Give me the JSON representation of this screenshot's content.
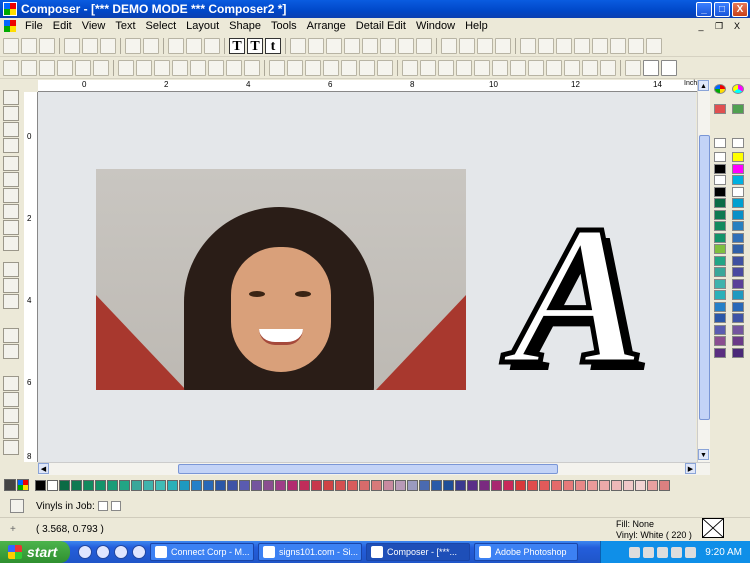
{
  "window": {
    "title": "Composer - [*** DEMO MODE *** Composer2 *]",
    "controls": {
      "minimize": "_",
      "maximize": "□",
      "close": "X"
    }
  },
  "menu": {
    "items": [
      "File",
      "Edit",
      "View",
      "Text",
      "Select",
      "Layout",
      "Shape",
      "Tools",
      "Arrange",
      "Detail Edit",
      "Window",
      "Help"
    ],
    "mdi_controls": {
      "minimize": "_",
      "restore": "❐",
      "close": "X"
    }
  },
  "toolbar": {
    "text_buttons": [
      "T",
      "T",
      "t"
    ],
    "units": "Inches"
  },
  "rulers": {
    "top_marks": [
      "0",
      "2",
      "4",
      "6",
      "8",
      "10",
      "12",
      "14"
    ],
    "left_marks": [
      "0",
      "2",
      "4",
      "6",
      "8"
    ]
  },
  "canvas": {
    "letter": "A",
    "photo_alt": "portrait photo"
  },
  "colors": {
    "canvas_bg": "#e4e7ea",
    "bottom_palette": [
      "#000000",
      "#ffffff",
      "#0b6b45",
      "#0e7a52",
      "#128a5e",
      "#14946a",
      "#1a9c78",
      "#22a585",
      "#3aa79a",
      "#3fb3ac",
      "#3fbcb6",
      "#2ab0b8",
      "#1e99c0",
      "#2580c8",
      "#2868b8",
      "#2b57a8",
      "#3f53a6",
      "#5a5bb0",
      "#74549e",
      "#8a4e90",
      "#a03d88",
      "#b22a70",
      "#c02c5a",
      "#c8384c",
      "#d04444",
      "#d55050",
      "#d85c5c",
      "#d86b6b",
      "#d87a7a",
      "#c88aa0",
      "#b89ab8",
      "#9a9ac0",
      "#4a6ab0",
      "#2a5aa8",
      "#1e4e98",
      "#3a3a90",
      "#5a2e88",
      "#7a2a80",
      "#a82870",
      "#c8285a",
      "#d83a3a",
      "#e04c4c",
      "#e25a5a",
      "#e46a6a",
      "#e67a7a",
      "#e88888",
      "#ea9a9a",
      "#ecaaaa",
      "#eeb8b8",
      "#f0c8c8",
      "#f2d4d4",
      "#e8a0a0",
      "#dc8080"
    ],
    "right_palette": [
      "#ffffff",
      "#ffff00",
      "#000000",
      "#ff00ff",
      "#ffffff",
      "#00b0e0",
      "#000000",
      "#ffffff",
      "#0b6b45",
      "#00a0d0",
      "#0e7a52",
      "#0890c8",
      "#128a5e",
      "#2880c0",
      "#14946a",
      "#3070b8",
      "#7fbf3f",
      "#3060a8",
      "#22a585",
      "#3f50a0",
      "#3aa79a",
      "#4a4aa0",
      "#3fb3ac",
      "#5a4098",
      "#2ab0b8",
      "#1e99c0",
      "#2580c8",
      "#2868b8",
      "#2b57a8",
      "#3f53a6",
      "#5a5bb0",
      "#74549e",
      "#8a4e90",
      "#6a3a88",
      "#5a2e80",
      "#4a2878"
    ]
  },
  "status": {
    "vinyls_label": "Vinyls in Job:",
    "coordinates": "( 3.568, 0.793 )",
    "fill": "Fill: None",
    "vinyl": "Vinyl: White ( 220 )"
  },
  "taskbar": {
    "start_label": "start",
    "tasks": [
      "Connect Corp - M...",
      "signs101.com - Si...",
      "Composer - [***...",
      "Adobe Photoshop"
    ],
    "clock": "9:20 AM"
  }
}
